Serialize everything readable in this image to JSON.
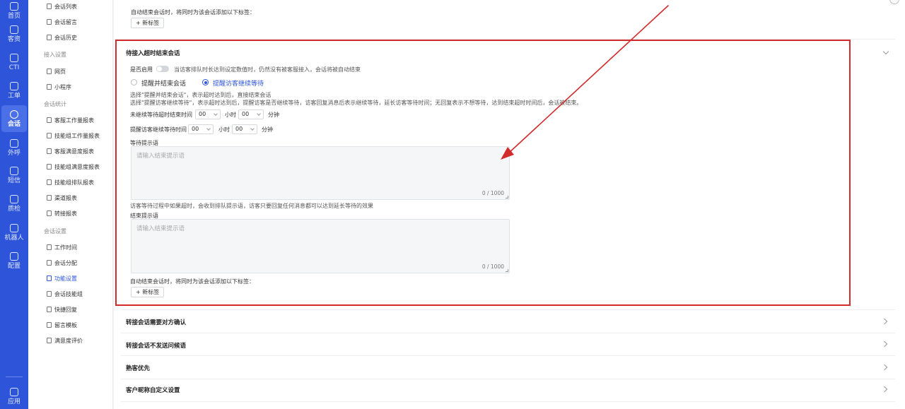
{
  "rail": {
    "items": [
      {
        "label": "首页",
        "icon": "home-icon"
      },
      {
        "label": "客资",
        "icon": "contacts-icon"
      },
      {
        "label": "CTI",
        "icon": "cti-icon"
      },
      {
        "label": "工单",
        "icon": "ticket-icon"
      },
      {
        "label": "会话",
        "icon": "chat-icon",
        "active": true
      },
      {
        "label": "外呼",
        "icon": "phone-icon"
      },
      {
        "label": "短信",
        "icon": "sms-icon"
      },
      {
        "label": "质检",
        "icon": "inspection-icon"
      },
      {
        "label": "机器人",
        "icon": "robot-icon"
      },
      {
        "label": "配置",
        "icon": "settings-icon"
      },
      {
        "label": "应用",
        "icon": "apps-icon"
      }
    ]
  },
  "subnav": {
    "items_top": [
      "会话列表",
      "会话留言",
      "会话历史"
    ],
    "group_access": "接入设置",
    "items_access": [
      "网页",
      "小程序"
    ],
    "group_stats": "会话统计",
    "items_stats": [
      "客服工作量报表",
      "技能组工作量报表",
      "客服满意度报表",
      "技能组满意度报表",
      "技能组排队报表",
      "渠道报表",
      "转接报表"
    ],
    "group_settings": "会话设置",
    "items_settings": [
      "工作时间",
      "会话分配",
      "功能设置",
      "会话技能组",
      "快捷回复",
      "留言模板",
      "满意度评价"
    ],
    "active_item": "功能设置"
  },
  "top_section": {
    "auto_end_tag_label": "自动结束会话时，将同时为该会话添加以下标签：",
    "new_tag_button": "+ 新标签"
  },
  "queue_timeout": {
    "title": "待接入超时结束会话",
    "enable_label": "是否启用",
    "enable_hint": "当访客排队时长达到设定数值时，仍然没有被客服接入，会话将被自动结束",
    "enabled": false,
    "radio_end": "提醒并结束会话",
    "radio_remind": "提醒访客继续等待",
    "selected_radio": "提醒访客继续等待",
    "desc_1": "选择\"提醒并结束会话\"，表示超时达到后，直接结束会话",
    "desc_2": "选择\"提醒访客继续等待\"，表示超时达到后，提醒访客是否继续等待，访客回复消息后表示继续等待，延长访客等待时间；无回复表示不想等待，达到结束超时时间后，会话被结束。",
    "no_continue_label": "未继续等待超时结束时间",
    "remind_label": "提醒访客继续等待时间",
    "hours_value": "00",
    "hours_unit": "小时",
    "minutes_value": "00",
    "minutes_unit": "分钟",
    "wait_prompt_label": "等待提示语",
    "wait_prompt_placeholder": "请输入结束提示语",
    "wait_prompt_count": "0 / 1000",
    "wait_prompt_hint": "访客等待过程中如果超时，会收到排队提示语，访客只要回复任何消息都可以达到延长等待的效果",
    "end_prompt_label": "结束提示语",
    "end_prompt_placeholder": "请输入结束提示语",
    "end_prompt_count": "0 / 1000",
    "auto_end_tag_label": "自动结束会话时，将同时为该会话添加以下标签：",
    "new_tag_button": "+ 新标签"
  },
  "collapsed_sections": [
    "转接会话需要对方确认",
    "转接会话不发送问候语",
    "熟客优先",
    "客户昵称自定义设置"
  ],
  "colors": {
    "rail": "#2e55d9",
    "accent": "#2e55d9",
    "annotation": "#d12b2b"
  }
}
